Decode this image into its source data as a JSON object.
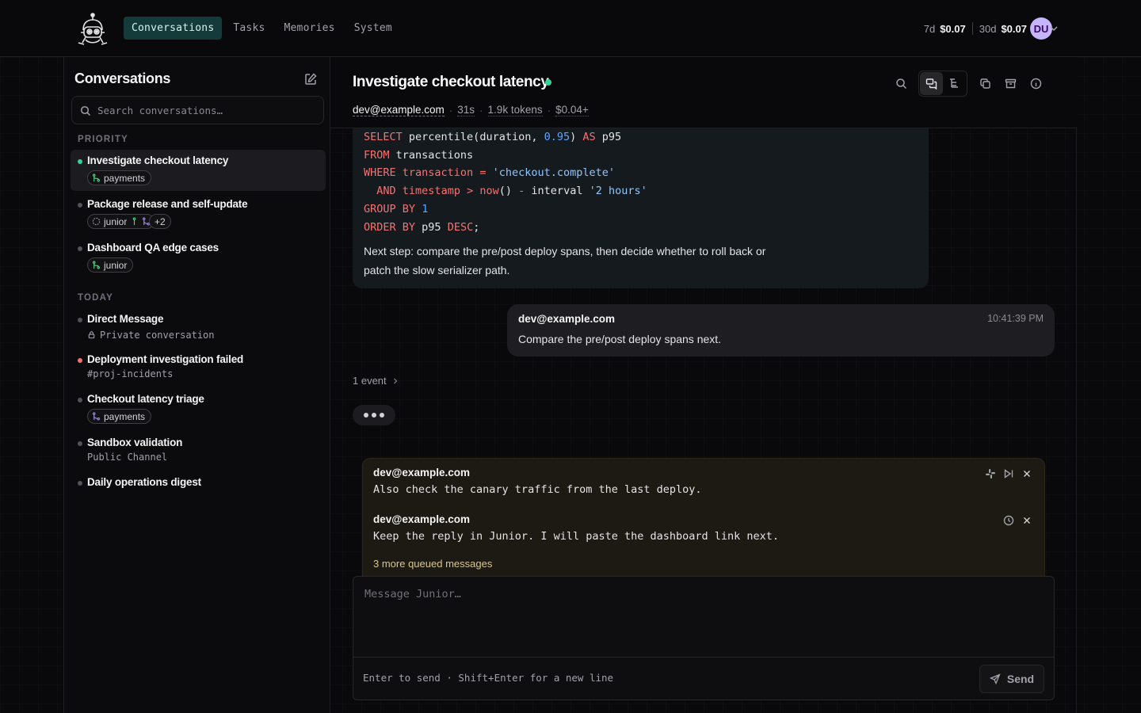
{
  "nav": {
    "tabs": [
      {
        "label": "Conversations",
        "active": true
      },
      {
        "label": "Tasks"
      },
      {
        "label": "Memories"
      },
      {
        "label": "System"
      }
    ]
  },
  "usage": {
    "seven_day_label": "7d",
    "seven_day_value": "$0.07",
    "thirty_day_label": "30d",
    "thirty_day_value": "$0.07"
  },
  "user": {
    "initials": "DU"
  },
  "sidebar": {
    "title": "Conversations",
    "search_placeholder": "Search conversations…",
    "sections": [
      {
        "label": "PRIORITY",
        "items": [
          {
            "title": "Investigate checkout latency",
            "status": "active",
            "chips": [
              {
                "icon": "merge-icon",
                "label": "payments"
              }
            ]
          },
          {
            "title": "Package release and self-update",
            "chips": [
              {
                "icon": "spinner-icon",
                "label": "junior"
              }
            ],
            "extra": "+2"
          },
          {
            "title": "Dashboard QA edge cases",
            "chips": [
              {
                "icon": "merge-icon",
                "label": "junior"
              }
            ]
          }
        ]
      },
      {
        "label": "TODAY",
        "items": [
          {
            "title": "Direct Message",
            "sub": "Private conversation"
          },
          {
            "title": "Deployment investigation failed",
            "status": "failed",
            "sub": "#proj-incidents"
          },
          {
            "title": "Checkout latency triage",
            "chips": [
              {
                "icon": "branch-icon",
                "label": "payments"
              }
            ]
          },
          {
            "title": "Sandbox validation",
            "sub": "Public Channel"
          },
          {
            "title": "Daily operations digest"
          }
        ]
      }
    ]
  },
  "chat": {
    "title": "Investigate checkout latency",
    "meta": {
      "email": "dev@example.com",
      "duration": "31s",
      "tokens": "1.9k tokens",
      "cost": "$0.04+"
    },
    "code_lines": [
      "SELECT percentile(duration, 0.95) AS p95",
      "FROM transactions",
      "WHERE transaction = 'checkout.complete'",
      "  AND timestamp > now() - interval '2 hours'",
      "GROUP BY 1",
      "ORDER BY p95 DESC;"
    ],
    "assistant_note": "Next step: compare the pre/post deploy spans, then decide whether to roll back or patch the slow serializer path.",
    "user_message": {
      "author": "dev@example.com",
      "time": "10:41:39 PM",
      "text": "Compare the pre/post deploy spans next."
    },
    "events_label": "1 event",
    "queue": [
      {
        "author": "dev@example.com",
        "text": "Also check the canary traffic from the last deploy."
      },
      {
        "author": "dev@example.com",
        "text": "Keep the reply in Junior. I will paste the dashboard link next."
      }
    ],
    "queue_more": "3 more queued messages",
    "composer": {
      "placeholder": "Message Junior…",
      "hint": "Enter to send · Shift+Enter for a new line",
      "send_label": "Send"
    }
  },
  "colors": {
    "accent": "#143a3a",
    "status_active": "#34d399",
    "status_failed": "#f87171",
    "avatar": "#c4b5fd"
  }
}
